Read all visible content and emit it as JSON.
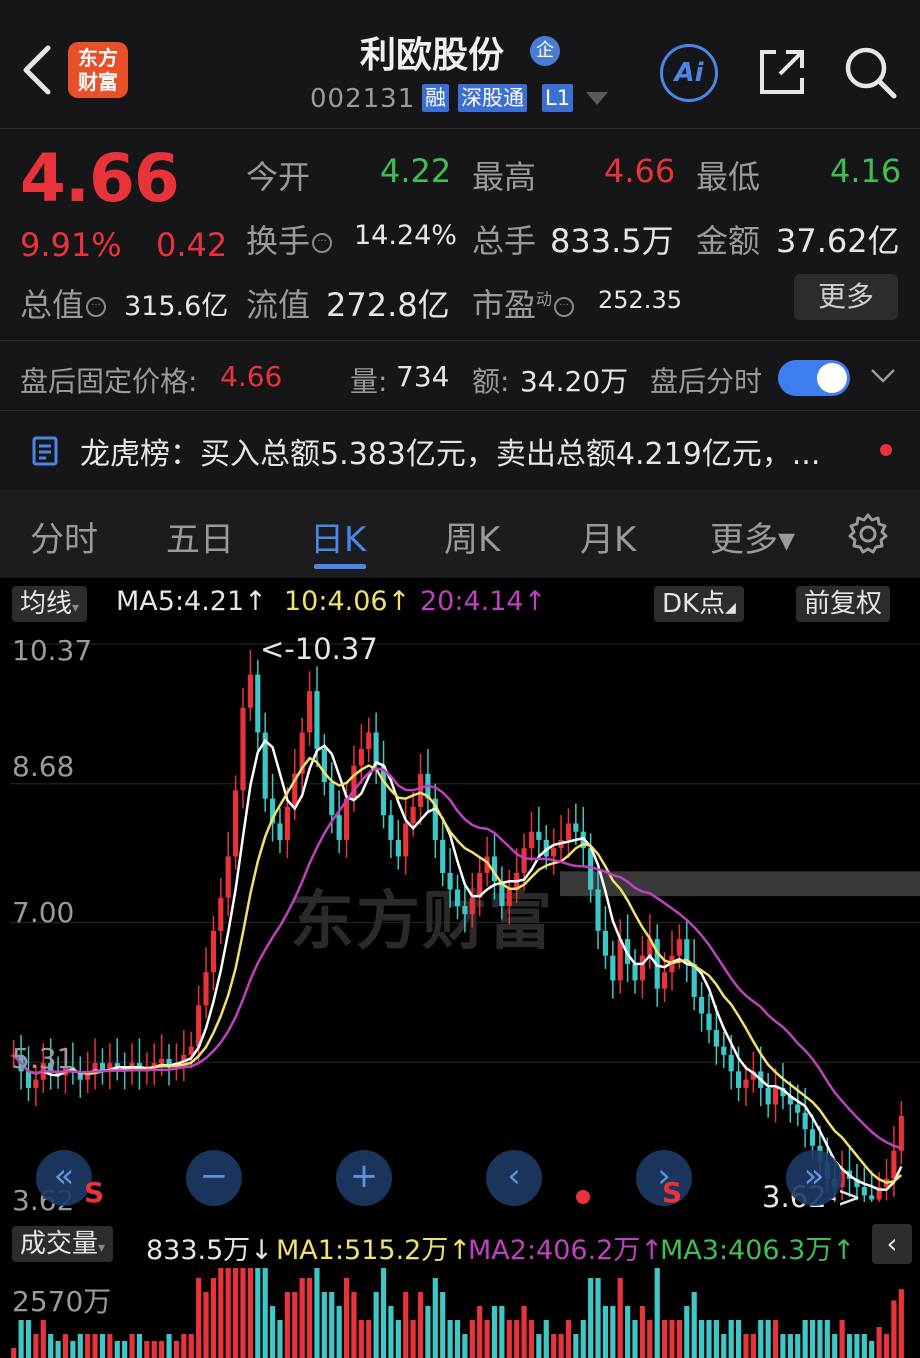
{
  "header": {
    "title": "利欧股份",
    "qi_badge": "企",
    "code": "002131",
    "tags": [
      "融",
      "深股通",
      "L1"
    ],
    "logo_line1": "东方",
    "logo_line2": "财富",
    "ai_label": "Ai"
  },
  "quote": {
    "price": "4.66",
    "change_pct": "9.91%",
    "change": "0.42",
    "open_label": "今开",
    "open": "4.22",
    "high_label": "最高",
    "high": "4.66",
    "low_label": "最低",
    "low": "4.16",
    "turnover_label": "换手",
    "turnover": "14.24%",
    "volume_label": "总手",
    "volume": "833.5万",
    "amount_label": "金额",
    "amount": "37.62亿",
    "mktcap_label": "总值",
    "mktcap": "315.6亿",
    "float_label": "流值",
    "float": "272.8亿",
    "pe_label": "市盈",
    "pe_sup": "动",
    "pe": "252.35",
    "more_label": "更多"
  },
  "afterhours": {
    "label": "盘后固定价格:",
    "price": "4.66",
    "vol_label": "量:",
    "vol": "734",
    "amt_label": "额:",
    "amt": "34.20万",
    "toggle_label": "盘后分时",
    "toggle_on": true
  },
  "lhb": {
    "text": "龙虎榜：买入总额5.383亿元，卖出总额4.219亿元，..."
  },
  "tabs": [
    {
      "label": "分时"
    },
    {
      "label": "五日"
    },
    {
      "label": "日K",
      "active": true
    },
    {
      "label": "周K"
    },
    {
      "label": "月K"
    },
    {
      "label": "更多▾"
    }
  ],
  "chart_toolbar": {
    "indicator": "均线",
    "ma5": "MA5:4.21↑",
    "ma10": "10:4.06↑",
    "ma20": "20:4.14↑",
    "dk": "DK点",
    "adjust": "前复权"
  },
  "y_axis": [
    "10.37",
    "8.68",
    "7.00",
    "5.31",
    "3.62"
  ],
  "annotations": {
    "max": "<-10.37",
    "min": "3.62->"
  },
  "watermark": "东方财富",
  "volume_bar": {
    "label": "成交量",
    "value": "833.5万↓",
    "ma1": "MA1:515.2万↑",
    "ma2": "MA2:406.2万↑",
    "ma3": "MA3:406.3万↑",
    "ymax": "2570万"
  },
  "colors": {
    "up": "#e8333a",
    "down": "#3fc7c7",
    "ma5": "#ffffff",
    "ma10": "#f0e070",
    "ma20": "#c040c0",
    "accent": "#4a86e8"
  },
  "chart_data": {
    "type": "candlestick",
    "ylim": [
      3.62,
      10.37
    ],
    "close_series": [
      5.4,
      5.2,
      5.0,
      5.1,
      5.3,
      5.2,
      5.15,
      5.25,
      5.2,
      5.1,
      5.2,
      5.3,
      5.2,
      5.3,
      5.25,
      5.2,
      5.3,
      5.2,
      5.25,
      5.3,
      5.35,
      5.25,
      5.3,
      5.4,
      5.5,
      6.0,
      6.4,
      6.9,
      7.3,
      7.8,
      8.6,
      9.6,
      10.0,
      9.3,
      8.5,
      8.2,
      8.0,
      8.4,
      8.8,
      9.3,
      9.8,
      9.1,
      8.7,
      8.3,
      8.0,
      8.5,
      8.9,
      9.1,
      9.3,
      8.9,
      8.3,
      8.0,
      7.8,
      8.2,
      8.4,
      8.8,
      8.5,
      8.0,
      7.6,
      7.4,
      7.2,
      7.1,
      7.3,
      7.6,
      7.8,
      7.5,
      7.2,
      7.4,
      7.6,
      7.9,
      8.1,
      8.0,
      7.8,
      7.9,
      8.0,
      8.2,
      8.1,
      7.9,
      7.4,
      6.9,
      6.6,
      6.3,
      6.8,
      6.5,
      6.3,
      6.6,
      6.8,
      6.2,
      6.4,
      6.6,
      6.8,
      6.5,
      6.1,
      5.9,
      5.7,
      5.5,
      5.4,
      5.2,
      5.0,
      5.1,
      5.2,
      5.0,
      4.8,
      5.0,
      4.9,
      4.8,
      4.7,
      4.5,
      4.3,
      4.1,
      3.9,
      3.8,
      4.0,
      3.9,
      3.8,
      3.7,
      3.65,
      3.8,
      3.9,
      4.24,
      4.66
    ]
  }
}
